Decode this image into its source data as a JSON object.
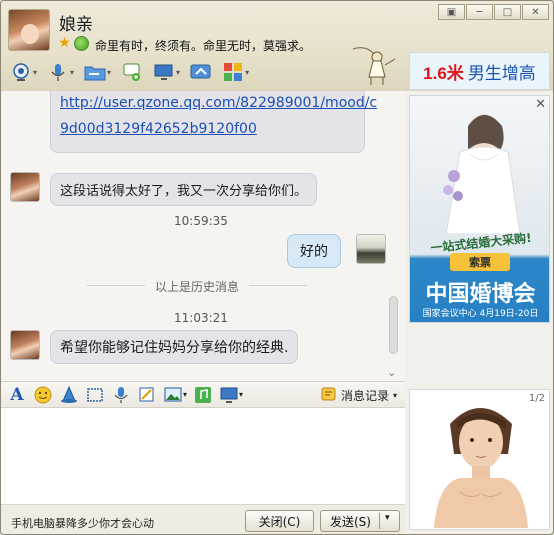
{
  "header": {
    "contact_name": "娘亲",
    "signature": "命里有时，终须有。命里无时，莫强求。"
  },
  "window_buttons": [
    "▣",
    "─",
    "□",
    "✕"
  ],
  "ad_banner": {
    "highlight": "1.6米",
    "text": "男生增高"
  },
  "chat": {
    "link_line1": "http://user.qzone.qq.com/822989001/mood/c",
    "link_line2": "9d00d3129f42652b9120f00",
    "msg1": "这段话说得太好了，我又一次分享给你们。",
    "time1": "10:59:35",
    "msg2": "好的",
    "history_label": "以上是历史消息",
    "time2": "11:03:21",
    "msg3": "希望你能够记住妈妈分享给你的经典."
  },
  "input_toolbar": {
    "history_label": "消息记录"
  },
  "bottom_bar": {
    "promo": "手机电脑暴降多少你才会心动",
    "close_label": "关闭(C)",
    "send_label": "发送(S)"
  },
  "ad_side": {
    "tag": "一站式结婚大采购!",
    "ticket": "索票",
    "title": "中国婚博会",
    "subtitle": "国家会议中心  4月19日-20日"
  },
  "avatar_panel": {
    "page": "1/2"
  }
}
